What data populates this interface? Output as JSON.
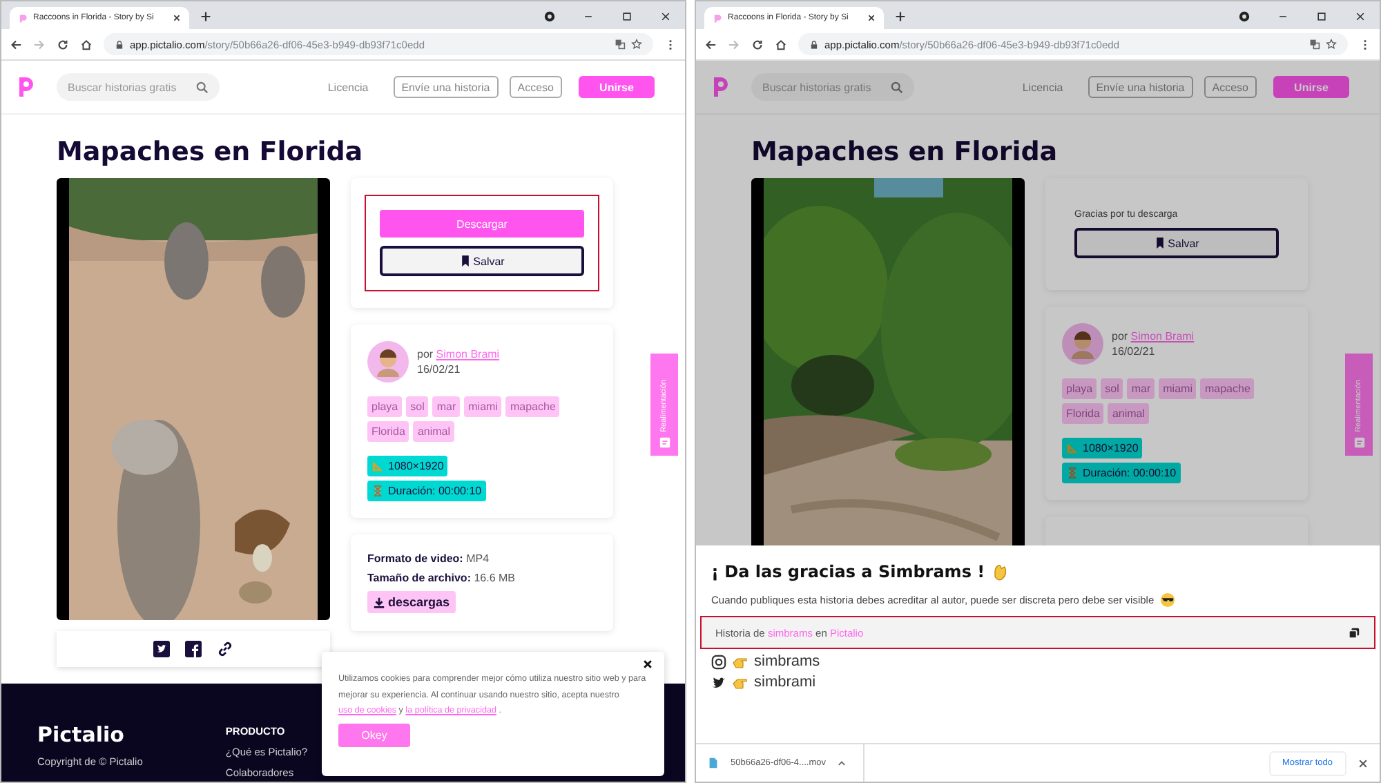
{
  "windows": [
    {
      "tab": {
        "title": "Raccoons in Florida - Story by Si"
      },
      "url": {
        "host": "app.pictalio.com",
        "path": "/story/50b66a26-df06-45e3-b949-db93f71c0edd"
      },
      "header": {
        "search_placeholder": "Buscar historias gratis",
        "license": "Licencia",
        "submit": "Envíe una historia",
        "login": "Acceso",
        "join": "Unirse"
      },
      "dimmed": false,
      "title": "Mapaches en Florida",
      "download_card": {
        "kind": "buttons",
        "download": "Descargar",
        "save": "Salvar",
        "highlighted": true
      },
      "author": {
        "prefix": "por",
        "name": "Simon Brami",
        "date": "16/02/21"
      },
      "tags": [
        "playa",
        "sol",
        "mar",
        "miami",
        "mapache",
        "Florida",
        "animal"
      ],
      "specs": [
        {
          "kind": "resolution",
          "text": "1080×1920"
        },
        {
          "kind": "duration",
          "text": "Duración: 00:00:10"
        }
      ],
      "file_info": {
        "rows": [
          {
            "label": "Formato de video:",
            "value": "MP4"
          },
          {
            "label": "Tamaño de archivo:",
            "value": "16.6 MB"
          }
        ],
        "downloads": "descargas"
      },
      "share_bar": [
        {
          "kind": "twitter"
        },
        {
          "kind": "facebook"
        },
        {
          "kind": "link"
        }
      ],
      "feedback_tab": "Realimentación",
      "footer": {
        "brand": "Pictalio",
        "copyright": "Copyright de © Pictalio",
        "heading": "PRODUCTO",
        "links": [
          "¿Qué es Pictalio?",
          "Colaboradores"
        ]
      },
      "cookie_notice": {
        "text": "Utilizamos cookies para comprender mejor cómo utiliza nuestro sitio web y para mejorar su experiencia. Al continuar usando nuestro sitio, acepta nuestro",
        "cookie_link": "uso de cookies",
        "joiner": "y",
        "privacy_link": "la política de privacidad",
        "end": ".",
        "button": "Okey"
      }
    },
    {
      "tab": {
        "title": "Raccoons in Florida - Story by Si"
      },
      "url": {
        "host": "app.pictalio.com",
        "path": "/story/50b66a26-df06-45e3-b949-db93f71c0edd"
      },
      "header": {
        "search_placeholder": "Buscar historias gratis",
        "license": "Licencia",
        "submit": "Envíe una historia",
        "login": "Acceso",
        "join": "Unirse"
      },
      "dimmed": true,
      "title": "Mapaches en Florida",
      "download_card": {
        "kind": "thanks",
        "message": "Gracias por tu descarga",
        "save": "Salvar",
        "highlighted": false
      },
      "author": {
        "prefix": "por",
        "name": "Simon Brami",
        "date": "16/02/21"
      },
      "tags": [
        "playa",
        "sol",
        "mar",
        "miami",
        "mapache",
        "Florida",
        "animal"
      ],
      "specs": [
        {
          "kind": "resolution",
          "text": "1080×1920"
        },
        {
          "kind": "duration",
          "text": "Duración: 00:00:10"
        }
      ],
      "feedback_tab": "Realimentación",
      "thanks_panel": {
        "heading": "¡ Da las gracias a Simbrams !",
        "text": "Cuando publiques esta historia debes acreditar al autor, puede ser discreta pero debe ser visible",
        "attribution": {
          "prefix": "Historia de",
          "author": "simbrams",
          "middle": "en",
          "site": "Pictalio",
          "highlighted": true
        },
        "socials": [
          {
            "kind": "instagram",
            "handle": "simbrams"
          },
          {
            "kind": "twitter",
            "handle": "simbrami"
          }
        ]
      },
      "download_bar": {
        "file": "50b66a26-df06-4....mov",
        "show_all": "Mostrar todo"
      }
    }
  ]
}
